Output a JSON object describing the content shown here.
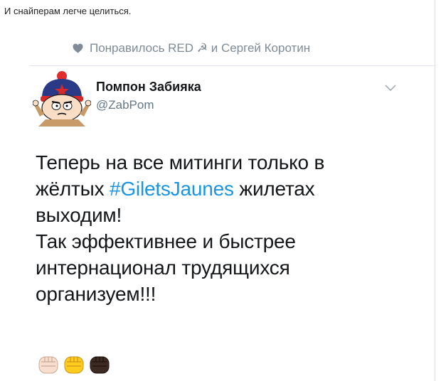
{
  "post": {
    "caption": "И снайперам легче целиться."
  },
  "embed": {
    "liked_by": "Понравилось RED ☭ и Сергей Коротин",
    "author": {
      "name": "Помпон Забияка",
      "handle": "@ZabPom"
    },
    "tweet": {
      "line1": "Теперь на все митинги только в",
      "line2_before": "жёлтых ",
      "hashtag": "#GiletsJaunes",
      "line2_after": " жилетах",
      "line3": "выходим!",
      "line4": "Так эффективнее и быстрее",
      "line5": "интернационал трудящихся",
      "line6": "организуем!!!"
    },
    "emojis": [
      "fist-light-icon",
      "fist-yellow-icon",
      "fist-dark-icon"
    ]
  },
  "colors": {
    "hashtag": "#1b95e0",
    "muted": "#7f8b96",
    "handle": "#657786",
    "text": "#14171a"
  }
}
